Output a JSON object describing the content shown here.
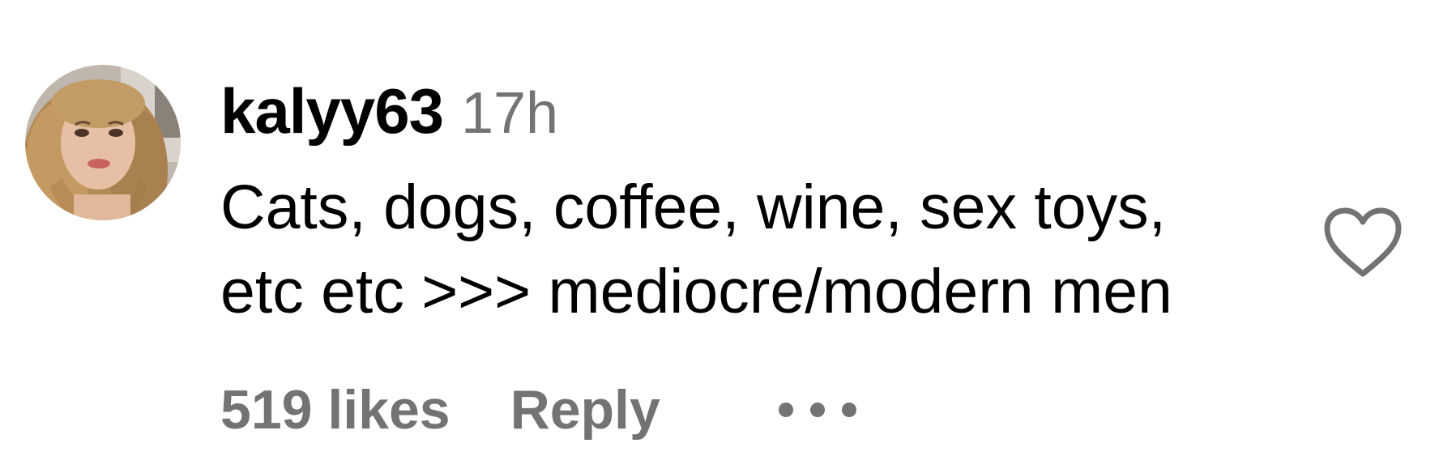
{
  "comment": {
    "username": "kalyy63",
    "timestamp": "17h",
    "text": "Cats, dogs, coffee, wine, sex toys,\netc etc >>> mediocre/modern men",
    "likes_label": "519 likes",
    "reply_label": "Reply",
    "avatar_icon": "user-avatar",
    "like_icon": "heart-outline-icon",
    "more_icon": "more-options-icon"
  },
  "colors": {
    "primary_text": "#000000",
    "secondary_text": "#737373",
    "background": "#ffffff"
  }
}
